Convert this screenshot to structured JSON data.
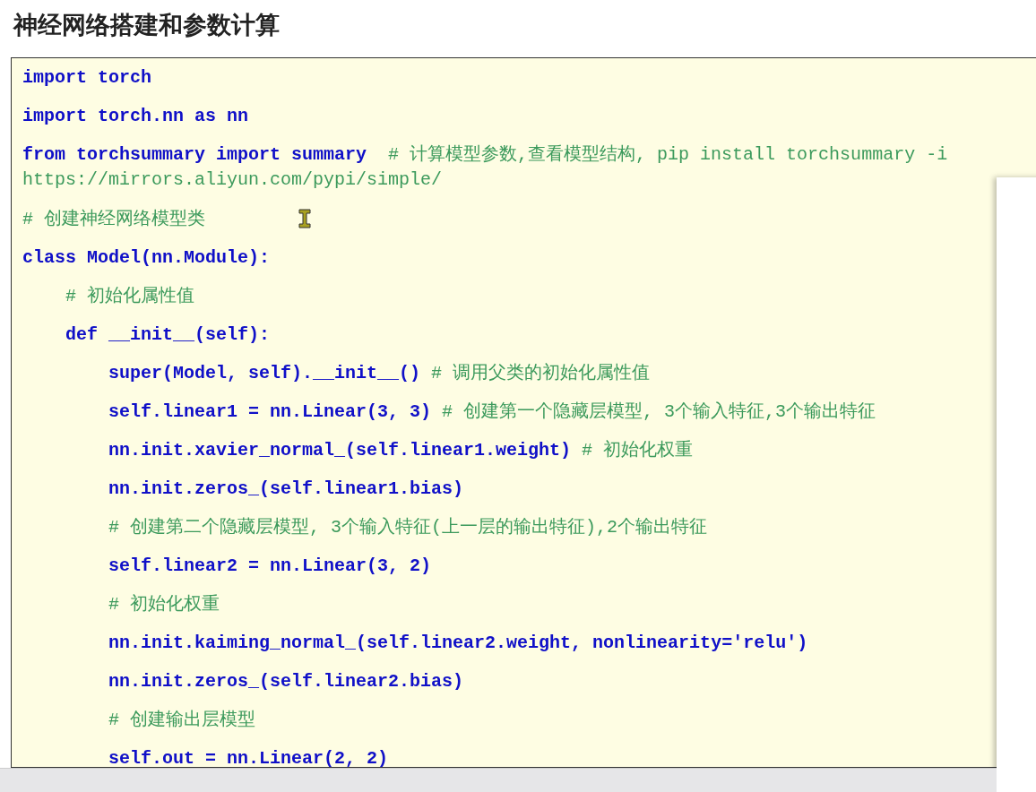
{
  "title": "神经网络搭建和参数计算",
  "code_lines": [
    {
      "kind": "line",
      "segments": [
        {
          "kind": "code",
          "text": "import torch"
        }
      ]
    },
    {
      "kind": "line",
      "segments": [
        {
          "kind": "code",
          "text": "import torch.nn as nn"
        }
      ]
    },
    {
      "kind": "line",
      "segments": [
        {
          "kind": "code",
          "text": "from torchsummary import summary  "
        },
        {
          "kind": "comment",
          "text": "# 计算模型参数,查看模型结构, pip install torchsummary -i"
        }
      ]
    },
    {
      "kind": "wrap",
      "segments": [
        {
          "kind": "comment",
          "text": "https://mirrors.aliyun.com/pypi/simple/"
        }
      ]
    },
    {
      "kind": "line",
      "segments": [
        {
          "kind": "comment",
          "text": "# 创建神经网络模型类"
        }
      ]
    },
    {
      "kind": "line",
      "segments": [
        {
          "kind": "code",
          "text": "class Model(nn.Module):"
        }
      ]
    },
    {
      "kind": "line",
      "segments": [
        {
          "kind": "comment",
          "text": "    # 初始化属性值"
        }
      ]
    },
    {
      "kind": "line",
      "segments": [
        {
          "kind": "code",
          "text": "    def __init__(self):"
        }
      ]
    },
    {
      "kind": "line",
      "segments": [
        {
          "kind": "code",
          "text": "        super(Model, self).__init__() "
        },
        {
          "kind": "comment",
          "text": "# 调用父类的初始化属性值"
        }
      ]
    },
    {
      "kind": "line",
      "segments": [
        {
          "kind": "code",
          "text": "        self.linear1 = nn.Linear(3, 3) "
        },
        {
          "kind": "comment",
          "text": "# 创建第一个隐藏层模型, 3个输入特征,3个输出特征"
        }
      ]
    },
    {
      "kind": "line",
      "segments": [
        {
          "kind": "code",
          "text": "        nn.init.xavier_normal_(self.linear1.weight) "
        },
        {
          "kind": "comment",
          "text": "# 初始化权重"
        }
      ]
    },
    {
      "kind": "line",
      "segments": [
        {
          "kind": "code",
          "text": "        nn.init.zeros_(self.linear1.bias)"
        }
      ]
    },
    {
      "kind": "line",
      "segments": [
        {
          "kind": "comment",
          "text": "        # 创建第二个隐藏层模型, 3个输入特征(上一层的输出特征),2个输出特征"
        }
      ]
    },
    {
      "kind": "line",
      "segments": [
        {
          "kind": "code",
          "text": "        self.linear2 = nn.Linear(3, 2)"
        }
      ]
    },
    {
      "kind": "line",
      "segments": [
        {
          "kind": "comment",
          "text": "        # 初始化权重"
        }
      ]
    },
    {
      "kind": "line",
      "segments": [
        {
          "kind": "code",
          "text": "        nn.init.kaiming_normal_(self.linear2.weight, nonlinearity='relu')"
        }
      ]
    },
    {
      "kind": "line",
      "segments": [
        {
          "kind": "code",
          "text": "        nn.init.zeros_(self.linear2.bias)"
        }
      ]
    },
    {
      "kind": "line",
      "segments": [
        {
          "kind": "comment",
          "text": "        # 创建输出层模型"
        }
      ]
    },
    {
      "kind": "line",
      "segments": [
        {
          "kind": "code",
          "text": "        self.out = nn.Linear(2, 2)"
        }
      ]
    }
  ]
}
